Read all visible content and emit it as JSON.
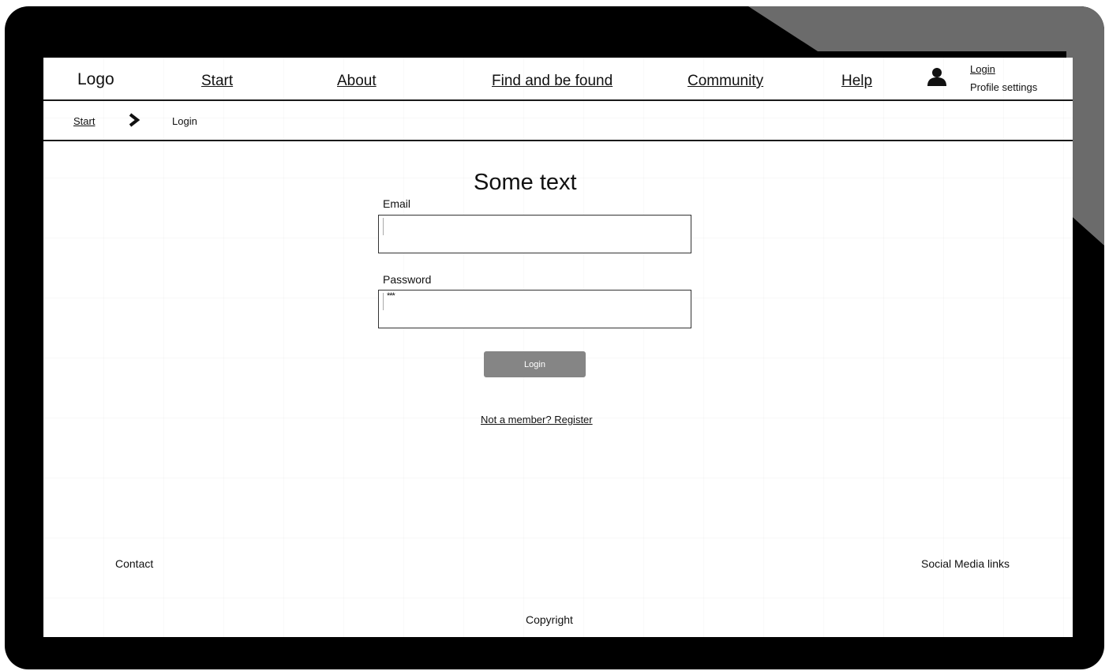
{
  "header": {
    "logo": "Logo",
    "nav": [
      {
        "label": "Start"
      },
      {
        "label": "About"
      },
      {
        "label": "Find and be found"
      },
      {
        "label": "Community"
      },
      {
        "label": "Help"
      }
    ],
    "user": {
      "icon": "user-icon",
      "login_label": "Login",
      "profile_label": "Profile settings"
    }
  },
  "breadcrumb": {
    "start": "Start",
    "separator_icon": "chevron-right-icon",
    "current": "Login"
  },
  "form": {
    "title": "Some text",
    "email_label": "Email",
    "email_value": "",
    "password_label": "Password",
    "password_value": "***",
    "submit_label": "Login",
    "register_link": "Not a member? Register"
  },
  "footer": {
    "contact": "Contact",
    "social": "Social Media links",
    "copyright": "Copyright"
  },
  "colors": {
    "frame": "#000000",
    "button": "#858585",
    "divider": "#1a1a1a"
  }
}
